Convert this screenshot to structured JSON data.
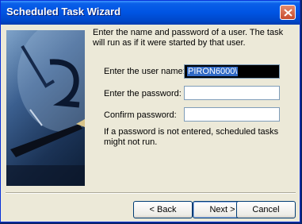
{
  "window": {
    "title": "Scheduled Task Wizard"
  },
  "icons": {
    "close": "close-icon",
    "art": "clock-and-pen-illustration"
  },
  "intro_text": "Enter the name and password of a user.  The task will run as if it were started by that user.",
  "fields": {
    "user": {
      "label": "Enter the user name:",
      "value": "PIRON6000\\"
    },
    "password": {
      "label": "Enter the password:",
      "value": ""
    },
    "confirm": {
      "label": "Confirm password:",
      "value": ""
    }
  },
  "note": "If a password is not entered, scheduled tasks might not run.",
  "buttons": {
    "back": "< Back",
    "next": "Next >",
    "cancel": "Cancel"
  },
  "colors": {
    "titlebar": "#0054e3",
    "dialog_bg": "#ece9d8",
    "selection": "#316ac5"
  }
}
